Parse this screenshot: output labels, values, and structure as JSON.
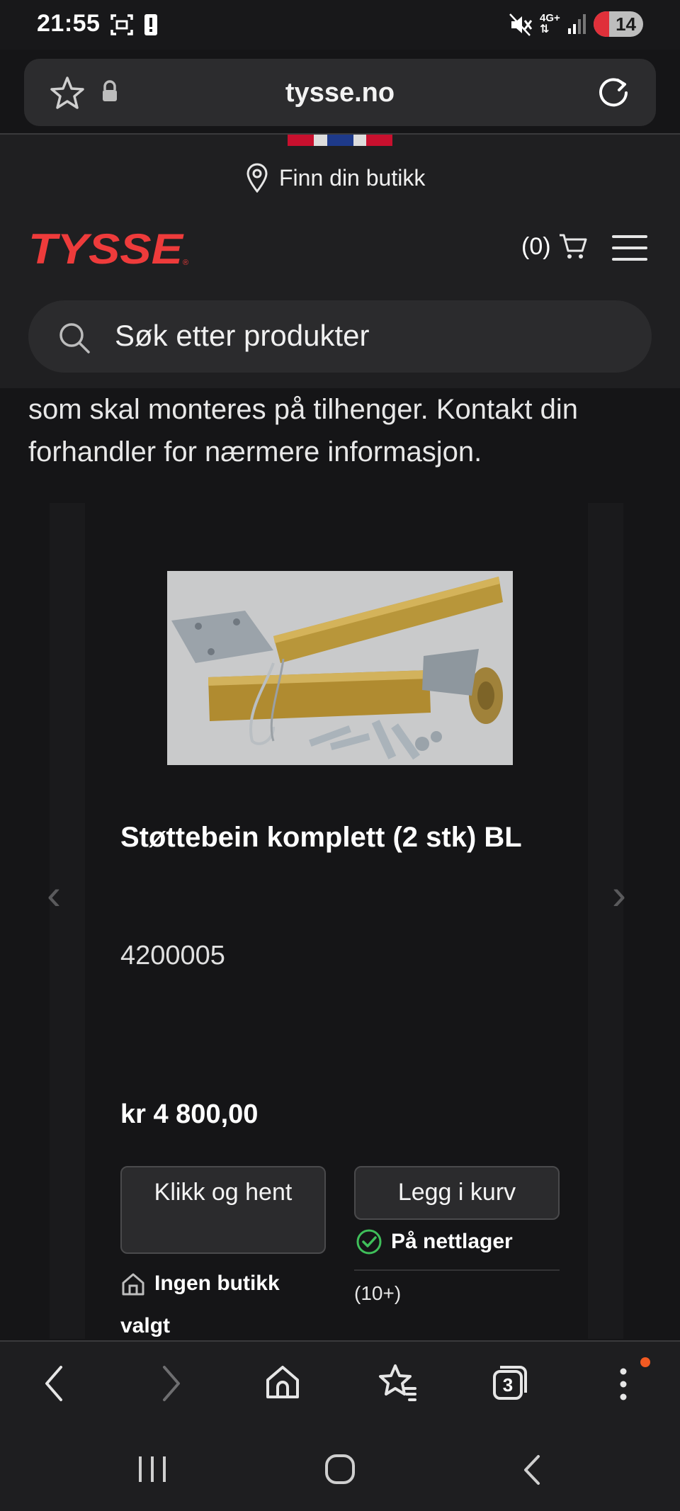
{
  "status_bar": {
    "time": "21:55",
    "network": "4G+",
    "battery": "14"
  },
  "browser": {
    "url": "tysse.no",
    "tab_count": "3"
  },
  "site": {
    "store_finder": "Finn din butikk",
    "logo_text": "TYSSE",
    "cart_count": "(0)",
    "search_placeholder": "Søk etter produkter",
    "brand_color": "#ee3b3b"
  },
  "content": {
    "description": "som skal monteres på tilhenger. Kontakt din forhandler for nærmere informasjon."
  },
  "product": {
    "title": "Støttebein komplett (2 stk) BL",
    "sku": "4200005",
    "price": "kr 4 800,00",
    "pickup_button": "Klikk og hent",
    "add_to_cart_button": "Legg i kurv",
    "stock_status": "På nettlager",
    "stock_count": "(10+)",
    "store_status": "Ingen butikk valgt"
  }
}
